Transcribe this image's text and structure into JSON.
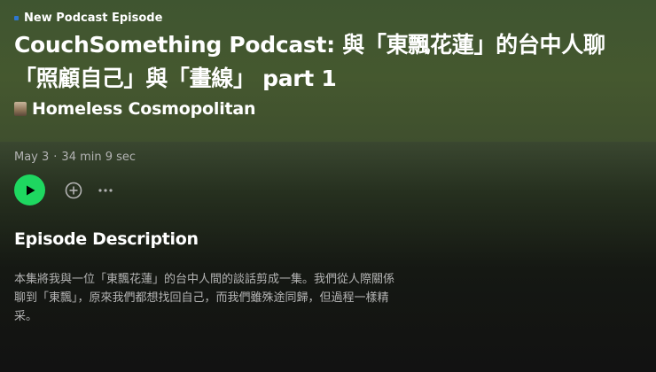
{
  "kicker": {
    "label": "New Podcast Episode"
  },
  "episode": {
    "title": "CouchSomething Podcast: 與「東飄花蓮」的台中人聊「照顧自己」與「畫線」 part 1",
    "show_name": "Homeless Cosmopolitan",
    "date": "May 3",
    "separator": "·",
    "duration": "34 min 9 sec"
  },
  "controls": {
    "play_icon": "play-icon",
    "add_icon": "plus-circle-icon",
    "more_icon": "more-horizontal-icon"
  },
  "description": {
    "heading": "Episode Description",
    "text": "本集將我與一位「東飄花蓮」的台中人間的談話剪成一集。我們從人際關係聊到「東飄」，原來我們都想找回自己，而我們雖殊途同歸，但過程一樣精采。"
  },
  "colors": {
    "accent": "#1ed760",
    "kicker_dot": "#2e77d0",
    "hero_bg": "#45582f",
    "page_bg": "#121212"
  }
}
